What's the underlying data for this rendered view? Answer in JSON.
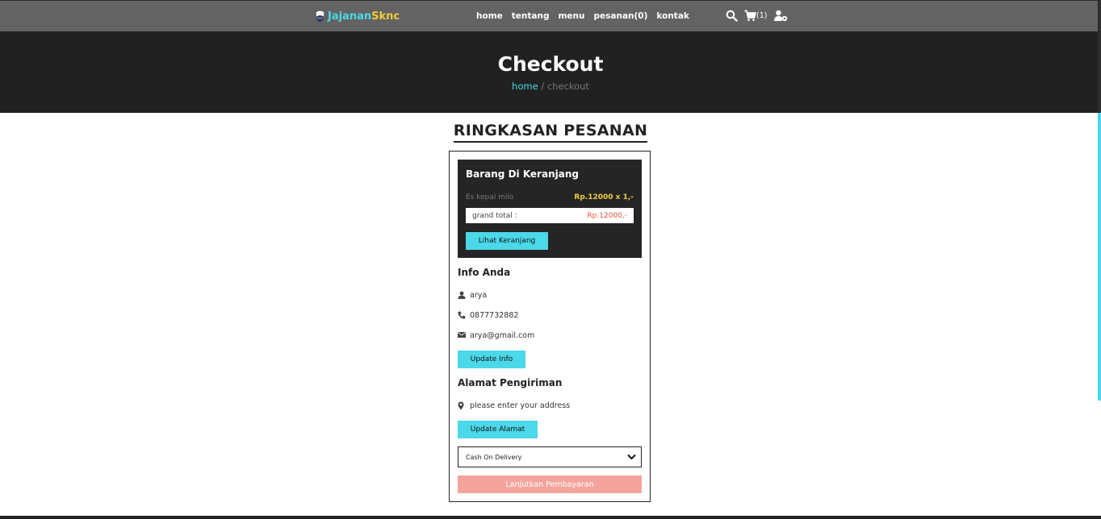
{
  "header": {
    "brand_part1": "Jajanan",
    "brand_part2": "Sknc",
    "nav": [
      "home",
      "tentang",
      "menu",
      "pesanan(0)",
      "kontak"
    ],
    "cart_count": "(1)"
  },
  "hero": {
    "title": "Checkout",
    "breadcrumb_home": "home",
    "breadcrumb_sep": " / ",
    "breadcrumb_current": "checkout"
  },
  "summary": {
    "title": "RINGKASAN PESANAN",
    "cart": {
      "title": "Barang Di Keranjang",
      "items": [
        {
          "name": "Es kepal milo",
          "price": "Rp.12000 x 1,-"
        }
      ],
      "grand_total_label": "grand total :",
      "grand_total_value": "Rp.12000,-",
      "view_cart_label": "Lihat Keranjang"
    },
    "info": {
      "title": "Info Anda",
      "name": "arya",
      "phone": "0877732882",
      "email": "arya@gmail.com",
      "update_label": "Update Info"
    },
    "address": {
      "title": "Alamat Pengiriman",
      "value": "please enter your address",
      "update_label": "Update Alamat"
    },
    "payment": {
      "selected": "Cash On Delivery"
    },
    "pay_label": "Lanjutkan Pembayaran"
  },
  "colors": {
    "accent": "#4bd8e8",
    "brand_yellow": "#f2cc3a",
    "dark_bg": "#212121",
    "nav_bg": "#636363",
    "pay_button": "#f4a49c"
  }
}
